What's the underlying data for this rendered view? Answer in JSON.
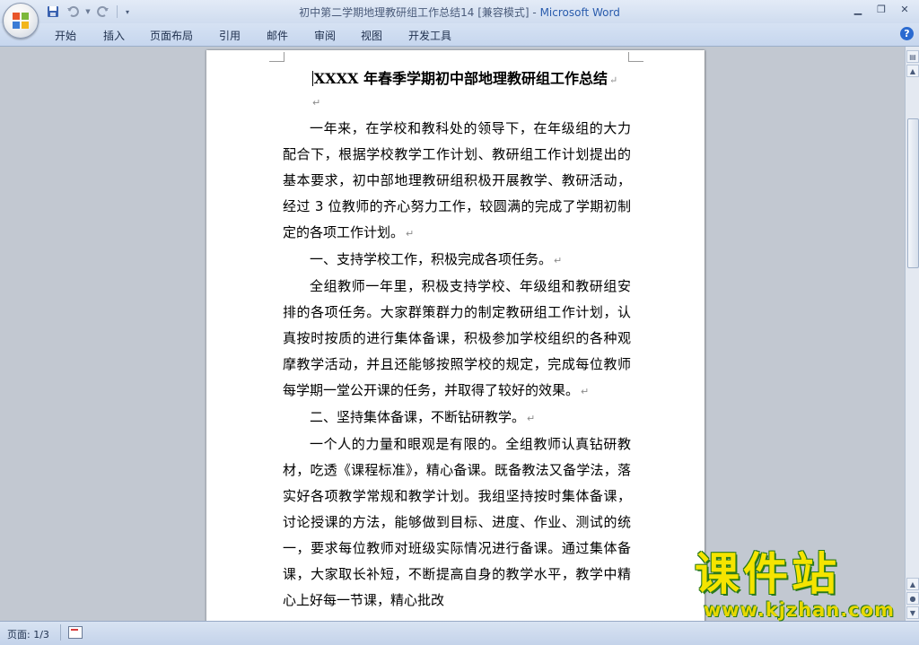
{
  "window": {
    "title_doc": "初中第二学期地理教研组工作总结14 [兼容模式] - ",
    "title_app": "Microsoft Word"
  },
  "ribbon": {
    "tabs": [
      "开始",
      "插入",
      "页面布局",
      "引用",
      "邮件",
      "审阅",
      "视图",
      "开发工具"
    ],
    "help": "?"
  },
  "document": {
    "title": "XXXX 年春季学期初中部地理教研组工作总结",
    "paragraph_mark": "↵",
    "paragraphs": [
      "一年来，在学校和教科处的领导下，在年级组的大力配合下，根据学校教学工作计划、教研组工作计划提出的基本要求，初中部地理教研组积极开展教学、教研活动，经过 3 位教师的齐心努力工作，较圆满的完成了学期初制定的各项工作计划。",
      "一、支持学校工作，积极完成各项任务。",
      "全组教师一年里，积极支持学校、年级组和教研组安排的各项任务。大家群策群力的制定教研组工作计划，认真按时按质的进行集体备课，积极参加学校组织的各种观摩教学活动，并且还能够按照学校的规定，完成每位教师每学期一堂公开课的任务，并取得了较好的效果。",
      "二、坚持集体备课，不断钻研教学。",
      "一个人的力量和眼观是有限的。全组教师认真钻研教材，吃透《课程标准》，精心备课。既备教法又备学法，落实好各项教学常规和教学计划。我组坚持按时集体备课，讨论授课的方法，能够做到目标、进度、作业、测试的统一，要求每位教师对班级实际情况进行备课。通过集体备课，大家取长补短，不断提高自身的教学水平，教学中精心上好每一节课，精心批改"
    ]
  },
  "statusbar": {
    "page": "页面: 1/3"
  },
  "watermark": {
    "brand": "课件站",
    "url": "www.kjzhan.com"
  }
}
